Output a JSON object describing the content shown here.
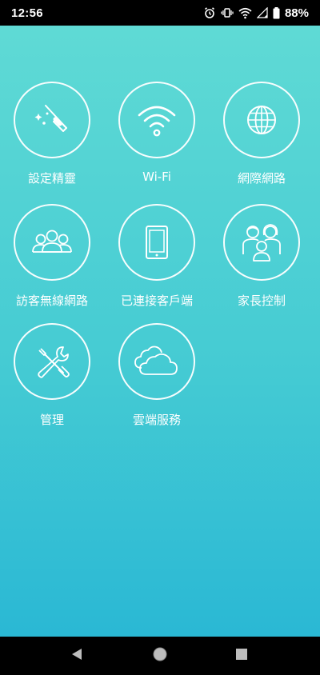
{
  "status_bar": {
    "time": "12:56",
    "battery": "88%",
    "icons": [
      "alarm-icon",
      "vibrate-icon",
      "wifi-signal-icon",
      "cell-signal-icon",
      "battery-icon"
    ]
  },
  "colors": {
    "gradient_top": "#5fdad5",
    "gradient_bottom": "#2ab8d4",
    "foreground": "#ffffff"
  },
  "menu": {
    "items": [
      {
        "label": "設定精靈",
        "icon": "magic-wand-icon"
      },
      {
        "label": "Wi-Fi",
        "icon": "wifi-icon"
      },
      {
        "label": "網際網路",
        "icon": "globe-icon"
      },
      {
        "label": "訪客無線網路",
        "icon": "guest-users-icon"
      },
      {
        "label": "已連接客戶端",
        "icon": "tablet-icon"
      },
      {
        "label": "家長控制",
        "icon": "family-icon"
      },
      {
        "label": "管理",
        "icon": "tools-icon"
      },
      {
        "label": "雲端服務",
        "icon": "cloud-icon"
      }
    ]
  },
  "nav_bar": {
    "buttons": [
      "back-icon",
      "home-icon",
      "recents-icon"
    ]
  }
}
